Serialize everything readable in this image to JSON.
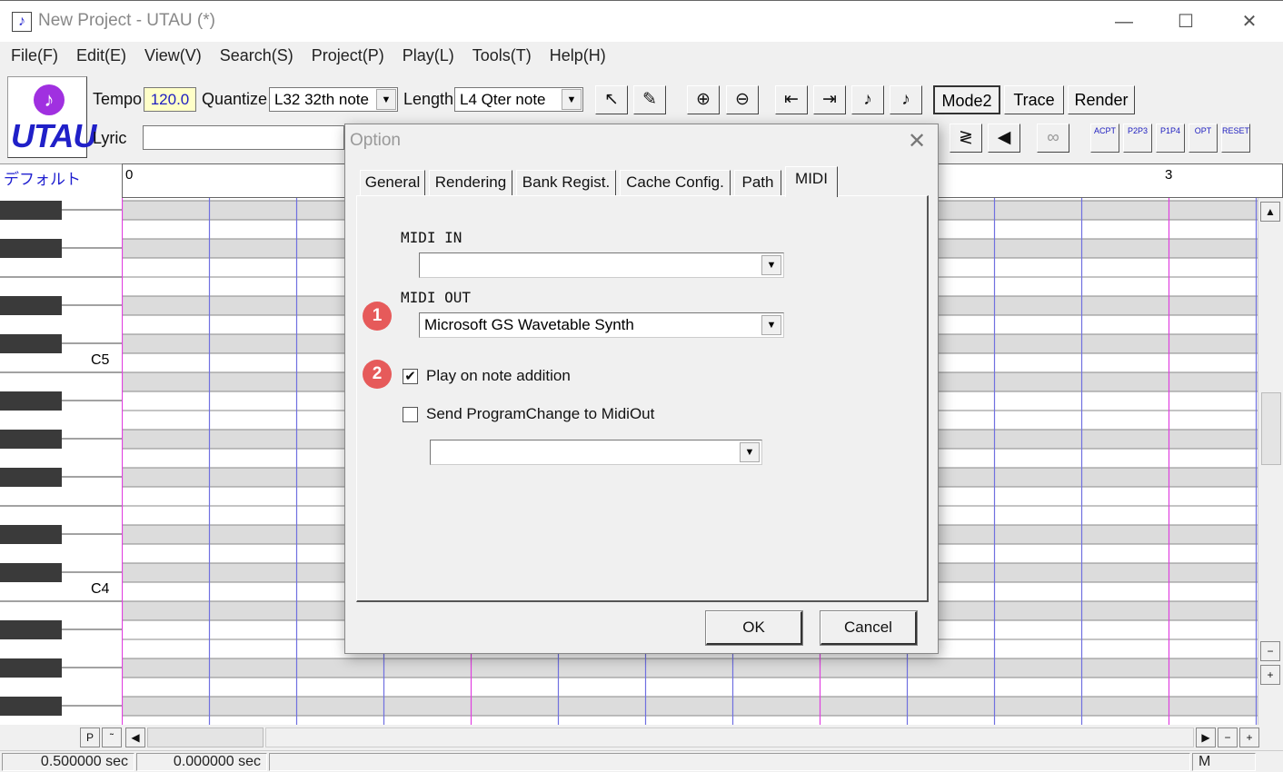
{
  "window": {
    "title": "New Project - UTAU (*)",
    "app_icon": "♪",
    "minimize_glyph": "—",
    "maximize_glyph": "☐",
    "close_glyph": "✕"
  },
  "menu": [
    "File(F)",
    "Edit(E)",
    "View(V)",
    "Search(S)",
    "Project(P)",
    "Play(L)",
    "Tools(T)",
    "Help(H)"
  ],
  "logo": {
    "text": "UTAU",
    "mark": "♪"
  },
  "toolbar": {
    "tempo_label": "Tempo",
    "tempo_value": "120.0",
    "quantize_label": "Quantize",
    "quantize_value": "L32 32th note",
    "length_label": "Length",
    "length_value": "L4  Qter note",
    "lyric_label": "Lyric",
    "lyric_value": "",
    "mode2_label": "Mode2",
    "trace_label": "Trace",
    "render_label": "Render",
    "icons": {
      "pointer": "↖",
      "pencil": "✎",
      "zoom_in": "⊕",
      "zoom_out": "⊖",
      "to_start": "⇤",
      "to_end": "⇥",
      "note_left": "♪",
      "note_right": "♪",
      "portamento": "≷",
      "stop": "◀",
      "loop": "∞"
    },
    "small_buttons": [
      "ACPT",
      "P2P3",
      "P1P4",
      "OPT",
      "RESET"
    ]
  },
  "track": {
    "name": "デフォルト",
    "ruler_marks": [
      "0",
      "3"
    ]
  },
  "piano": {
    "labels": [
      "C5",
      "C4"
    ]
  },
  "scroll": {
    "up": "▲",
    "down": "▼",
    "left": "◀",
    "right": "▶",
    "minus": "−",
    "plus": "+",
    "p": "P",
    "tilde": "˜"
  },
  "status": {
    "time1": "0.500000 sec",
    "time2": "0.000000 sec",
    "mode": "M"
  },
  "dialog": {
    "title": "Option",
    "close": "✕",
    "tabs": [
      "General",
      "Rendering",
      "Bank Regist.",
      "Cache Config.",
      "Path",
      "MIDI"
    ],
    "active_tab": "MIDI",
    "midi_in_label": "MIDI IN",
    "midi_in_value": "",
    "midi_out_label": "MIDI OUT",
    "midi_out_value": "Microsoft GS Wavetable Synth",
    "play_on_add_label": "Play on note addition",
    "play_on_add_checked": true,
    "send_pc_label": "Send ProgramChange to MidiOut",
    "send_pc_checked": false,
    "program_value": "",
    "ok_label": "OK",
    "cancel_label": "Cancel",
    "badges": [
      "1",
      "2"
    ],
    "check_glyph": "✔",
    "arrow_glyph": "▼"
  }
}
